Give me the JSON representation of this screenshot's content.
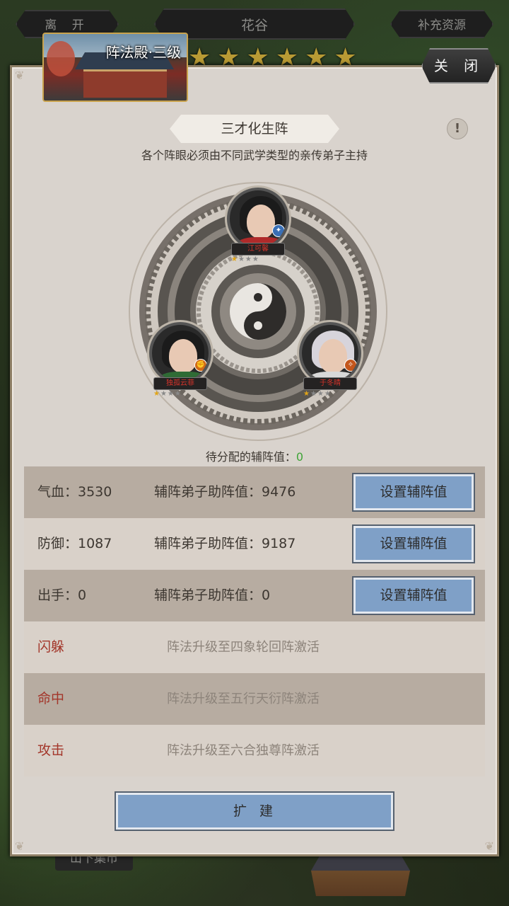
{
  "topbar": {
    "leave_label": "离 开",
    "area_label": "花谷",
    "resource_label": "补充资源"
  },
  "background": {
    "market_label": "山下集市"
  },
  "building": {
    "title": "阵法殿·三级",
    "star_count": 6
  },
  "close_label": "关 闭",
  "formation": {
    "name": "三才化生阵",
    "description": "各个阵眼必须由不同武学类型的亲传弟子主持",
    "disciples": [
      {
        "name": "江可馨",
        "stars": 1,
        "max_stars": 4,
        "robe_color": "#b02a2a",
        "badge_color": "#3a6fb5"
      },
      {
        "name": "独孤云菲",
        "stars": 1,
        "max_stars": 4,
        "robe_color": "#2f6b35",
        "badge_color": "#d06a1a"
      },
      {
        "name": "于冬晴",
        "stars": 1,
        "max_stars": 4,
        "robe_color": "#d8d8d8",
        "badge_color": "#c4561c"
      }
    ]
  },
  "allocation": {
    "label": "待分配的辅阵值：",
    "value": "0"
  },
  "stats": [
    {
      "stat": "气血：3530",
      "assist": "辅阵弟子助阵值：9476",
      "button": "设置辅阵值"
    },
    {
      "stat": "防御：1087",
      "assist": "辅阵弟子助阵值：9187",
      "button": "设置辅阵值"
    },
    {
      "stat": "出手：0",
      "assist": "辅阵弟子助阵值：0",
      "button": "设置辅阵值"
    }
  ],
  "locked": [
    {
      "label": "闪躲",
      "desc": "阵法升级至四象轮回阵激活"
    },
    {
      "label": "命中",
      "desc": "阵法升级至五行天衍阵激活"
    },
    {
      "label": "攻击",
      "desc": "阵法升级至六合独尊阵激活"
    }
  ],
  "expand_label": "扩建",
  "colors": {
    "panel": "#d9d3cd",
    "button": "#7fa0c7",
    "locked_text": "#a3362a",
    "star": "#e0a417"
  }
}
